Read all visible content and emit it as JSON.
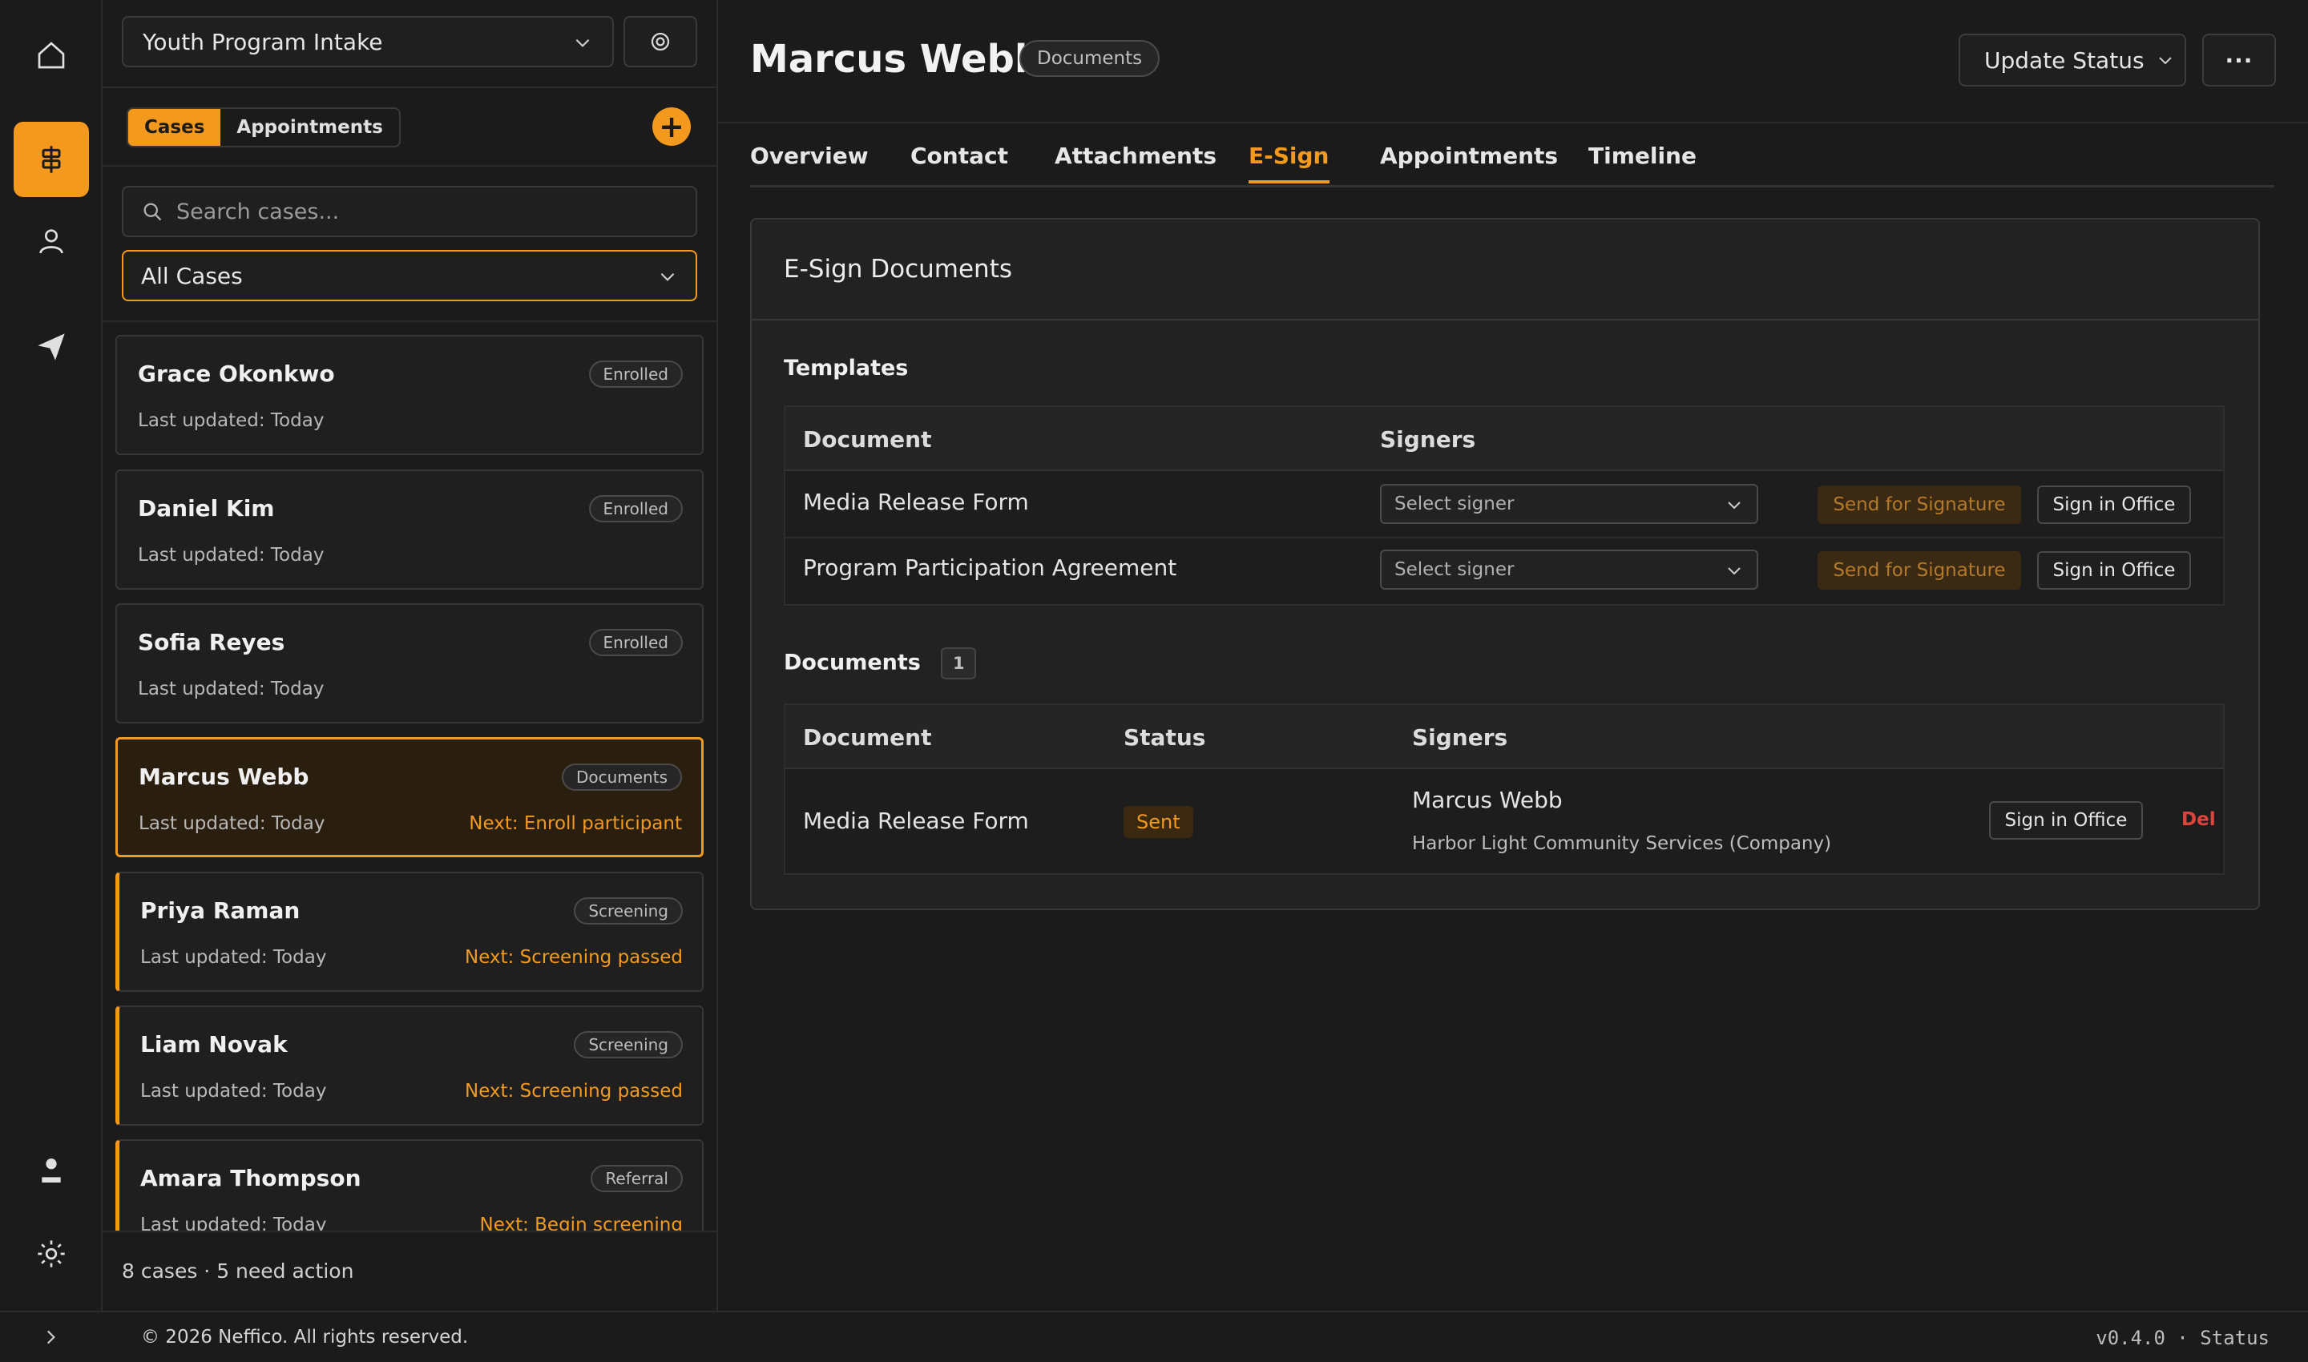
{
  "colors": {
    "accent": "#f39a1e",
    "danger": "#e0433b",
    "background": "#1b1b1b"
  },
  "rail": {
    "items": [
      {
        "name": "home-icon"
      },
      {
        "name": "cases-icon",
        "active": true
      },
      {
        "name": "user-icon"
      },
      {
        "name": "send-icon"
      }
    ],
    "bottom": [
      {
        "name": "profile-icon"
      },
      {
        "name": "settings-gear-icon"
      }
    ]
  },
  "list": {
    "program": "Youth Program Intake",
    "seg": {
      "cases": "Cases",
      "appointments": "Appointments"
    },
    "search_placeholder": "Search cases...",
    "filter": "All Cases",
    "cards": [
      {
        "name": "Grace Okonkwo",
        "updated": "Last updated: Today",
        "status": "Enrolled",
        "next": ""
      },
      {
        "name": "Daniel Kim",
        "updated": "Last updated: Today",
        "status": "Enrolled",
        "next": ""
      },
      {
        "name": "Sofia Reyes",
        "updated": "Last updated: Today",
        "status": "Enrolled",
        "next": ""
      },
      {
        "name": "Marcus Webb",
        "updated": "Last updated: Today",
        "status": "Documents",
        "next": "Next: Enroll participant"
      },
      {
        "name": "Priya Raman",
        "updated": "Last updated: Today",
        "status": "Screening",
        "next": "Next: Screening passed"
      },
      {
        "name": "Liam Novak",
        "updated": "Last updated: Today",
        "status": "Screening",
        "next": "Next: Screening passed"
      },
      {
        "name": "Amara Thompson",
        "updated": "Last updated: Today",
        "status": "Referral",
        "next": "Next: Begin screening"
      }
    ],
    "footer": "8 cases · 5 need action"
  },
  "main": {
    "title": "Marcus Webb",
    "badge": "Documents",
    "update_status": "Update Status",
    "more": "···",
    "tabs": [
      "Overview",
      "Contact",
      "Attachments",
      "E-Sign",
      "Appointments",
      "Timeline"
    ],
    "active_tab": "E-Sign",
    "panel_title": "E-Sign Documents",
    "templates": {
      "title": "Templates",
      "headers": [
        "Document",
        "Signers"
      ],
      "rows": [
        {
          "doc": "Media Release Form",
          "signer_placeholder": "Select signer",
          "send": "Send for Signature",
          "office": "Sign in Office"
        },
        {
          "doc": "Program Participation Agreement",
          "signer_placeholder": "Select signer",
          "send": "Send for Signature",
          "office": "Sign in Office"
        }
      ]
    },
    "documents": {
      "title": "Documents",
      "count": "1",
      "headers": [
        "Document",
        "Status",
        "Signers"
      ],
      "rows": [
        {
          "doc": "Media Release Form",
          "status": "Sent",
          "signer": "Marcus Webb",
          "signer_org": "Harbor Light Community Services (Company)",
          "office": "Sign in Office",
          "delete": "Del"
        }
      ]
    }
  },
  "footer": {
    "copyright": "© 2026 Neffico. All rights reserved.",
    "version": "v0.4.0 · Status"
  }
}
